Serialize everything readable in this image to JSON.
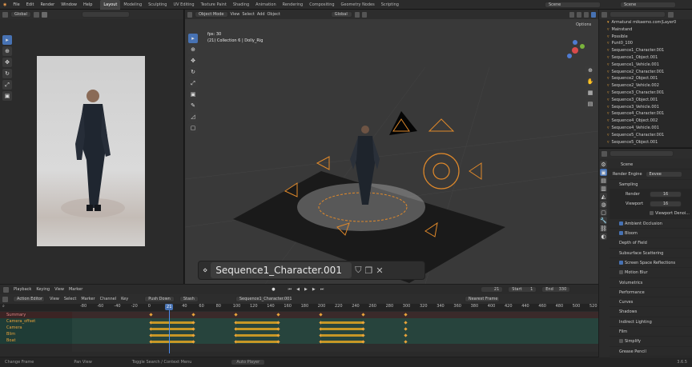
{
  "menubar": {
    "menus": [
      "File",
      "Edit",
      "Render",
      "Window",
      "Help"
    ],
    "workspaces": [
      "Layout",
      "Modeling",
      "Sculpting",
      "UV Editing",
      "Texture Paint",
      "Shading",
      "Animation",
      "Rendering",
      "Compositing",
      "Geometry Nodes",
      "Scripting"
    ],
    "active_workspace": "Layout",
    "scene": "Scene",
    "view_layer": "Scene"
  },
  "image_editor": {
    "header_global": "Global"
  },
  "viewport": {
    "header_mode": "Object Mode",
    "menus": [
      "View",
      "Select",
      "Add",
      "Object"
    ],
    "transform": "Global",
    "overlay_line1": "fps: 30",
    "overlay_line2": "(21) Collection 6 | Dolly_Rig",
    "options_label": "Options",
    "shot_name": "Sequence1_Character.001"
  },
  "outliner": {
    "items": [
      "Armatural mikaemo.com|Layer0",
      "Mainstand",
      "Possible",
      "Punt0_100",
      "Sequence1_Character.001",
      "Sequence1_Object.001",
      "Sequence1_Vehicle.001",
      "Sequence2_Character.001",
      "Sequence2_Object.001",
      "Sequence2_Vehicle.002",
      "Sequence3_Character.001",
      "Sequence3_Object.001",
      "Sequence3_Vehicle.001",
      "Sequence4_Character.001",
      "Sequence4_Object.002",
      "Sequence4_Vehicle.001",
      "Sequence5_Character.001",
      "Sequence5_Object.001"
    ]
  },
  "properties": {
    "title": "Scene",
    "render_engine_label": "Render Engine",
    "render_engine_value": "Eevee",
    "sampling_label": "Sampling",
    "render_label": "Render",
    "render_value": "16",
    "viewport_label": "Viewport",
    "viewport_value": "16",
    "viewport_denoise": "Viewport Denoi...",
    "panels": [
      {
        "label": "Ambient Occlusion",
        "checked": true
      },
      {
        "label": "Bloom",
        "checked": true
      },
      {
        "label": "Depth of Field",
        "checked": null
      },
      {
        "label": "Subsurface Scattering",
        "checked": null
      },
      {
        "label": "Screen Space Reflections",
        "checked": true
      },
      {
        "label": "Motion Blur",
        "checked": false
      },
      {
        "label": "Volumetrics",
        "checked": null
      },
      {
        "label": "Performance",
        "checked": null
      },
      {
        "label": "Curves",
        "checked": null
      },
      {
        "label": "Shadows",
        "checked": null
      },
      {
        "label": "Indirect Lighting",
        "checked": null
      },
      {
        "label": "Film",
        "checked": null
      },
      {
        "label": "Simplify",
        "checked": false
      },
      {
        "label": "Grease Pencil",
        "checked": null
      }
    ]
  },
  "playback": {
    "playback_label": "Playback",
    "keying_label": "Keying",
    "view_label": "View",
    "marker_label": "Marker",
    "current_frame": "21",
    "start_label": "Start",
    "start_value": "1",
    "end_label": "End",
    "end_value": "330"
  },
  "action_editor": {
    "mode": "Action Editor",
    "menus": [
      "View",
      "Select",
      "Marker",
      "Channel",
      "Key"
    ],
    "push_down": "Push Down",
    "stash": "Stash",
    "action_name": "Sequence1_Character.001",
    "interp": "Nearest Frame",
    "frame_ticks": [
      "-80",
      "-60",
      "-40",
      "-20",
      "0",
      "20",
      "40",
      "60",
      "80",
      "100",
      "120",
      "140",
      "160",
      "180",
      "200",
      "220",
      "240",
      "260",
      "280",
      "300",
      "320",
      "340",
      "360",
      "380",
      "400",
      "420",
      "440",
      "460",
      "480",
      "500",
      "520"
    ],
    "current_frame": "21",
    "channels": [
      {
        "name": "Summary",
        "color": "#d44b4b"
      },
      {
        "name": "Camera_offset",
        "color": "#e9a33a"
      },
      {
        "name": "Camera",
        "color": "#e9a33a"
      },
      {
        "name": "Blim",
        "color": "#e9a33a"
      },
      {
        "name": "Boat",
        "color": "#e9a33a"
      }
    ],
    "key_frames": [
      0,
      50,
      100,
      150,
      200,
      250,
      300
    ]
  },
  "statusbar": {
    "left": "Change Frame",
    "middle": "Pan View",
    "right_hint": "Toggle Search / Context Menu",
    "center": "Auto Player",
    "version": "3.6.5"
  }
}
